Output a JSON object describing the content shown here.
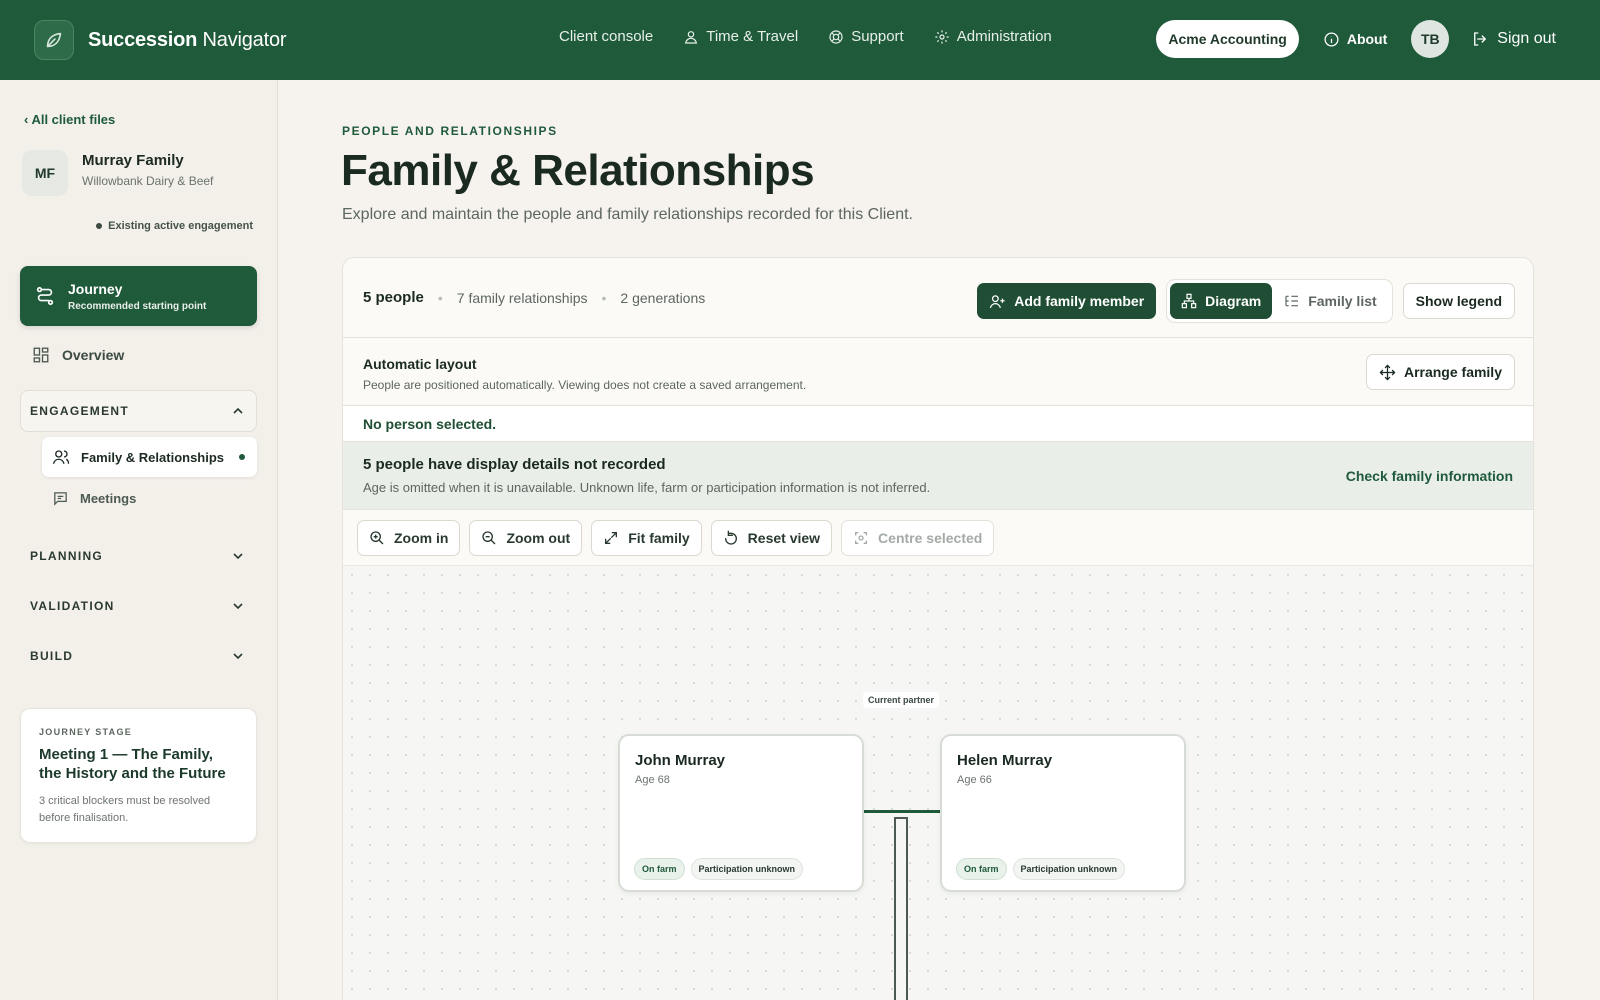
{
  "app": {
    "brand_bold": "Succession",
    "brand_rest": " Navigator",
    "nav": [
      {
        "label": "Client console",
        "icon": "none"
      },
      {
        "label": "Time & Travel",
        "icon": "user-pin-icon"
      },
      {
        "label": "Support",
        "icon": "lifebuoy-icon"
      },
      {
        "label": "Administration",
        "icon": "gear-icon"
      }
    ],
    "org": "Acme Accounting",
    "about": "About",
    "user_initials": "TB",
    "sign_out": "Sign out"
  },
  "sidebar": {
    "back": "‹ All client files",
    "client_initials": "MF",
    "client_name": "Murray Family",
    "client_sub": "Willowbank Dairy & Beef",
    "engagement_status": "Existing active engagement",
    "journey_title": "Journey",
    "journey_sub": "Recommended starting point",
    "overview": "Overview",
    "sections": {
      "engagement": "ENGAGEMENT",
      "planning": "PLANNING",
      "validation": "VALIDATION",
      "build": "BUILD"
    },
    "engagement_items": [
      "Family & Relationships",
      "Meetings"
    ],
    "stage": {
      "eyebrow": "JOURNEY STAGE",
      "title": "Meeting 1 — The Family, the History and the Future",
      "note": "3 critical blockers must be resolved before finalisation."
    }
  },
  "page": {
    "eyebrow": "PEOPLE AND RELATIONSHIPS",
    "title": "Family & Relationships",
    "description": "Explore and maintain the people and family relationships recorded for this Client."
  },
  "panel": {
    "people_count": "5 people",
    "relationships": "7 family relationships",
    "generations": "2 generations",
    "add_member": "Add family member",
    "view_diagram": "Diagram",
    "view_list": "Family list",
    "show_legend": "Show legend",
    "layout_title": "Automatic layout",
    "layout_sub": "People are positioned automatically. Viewing does not create a saved arrangement.",
    "arrange": "Arrange family",
    "selection": "No person selected.",
    "notice_title": "5 people have display details not recorded",
    "notice_sub": "Age is omitted when it is unavailable. Unknown life, farm or participation information is not inferred.",
    "notice_link": "Check family information",
    "tools": [
      "Zoom in",
      "Zoom out",
      "Fit family",
      "Reset view",
      "Centre selected"
    ]
  },
  "diagram": {
    "partner_label": "Current partner",
    "people": [
      {
        "name": "John Murray",
        "age": "Age 68",
        "chips": [
          "On farm",
          "Participation unknown"
        ]
      },
      {
        "name": "Helen Murray",
        "age": "Age 66",
        "chips": [
          "On farm",
          "Participation unknown"
        ]
      }
    ]
  },
  "colors": {
    "brand": "#1f5a3a",
    "background": "#f6f3ee"
  }
}
